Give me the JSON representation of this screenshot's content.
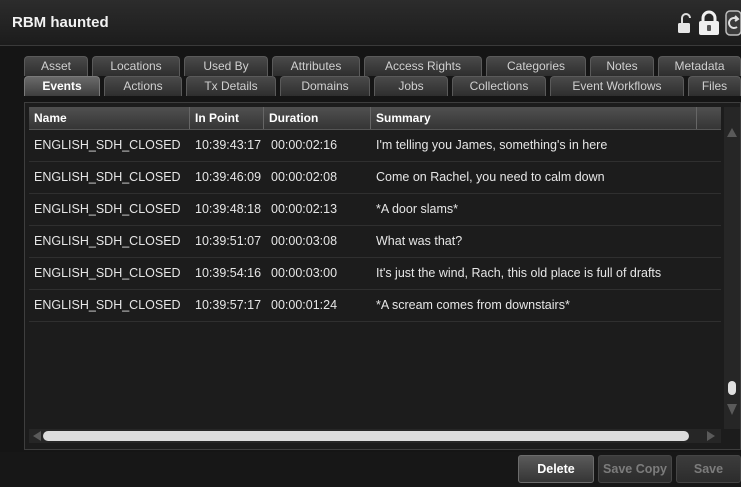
{
  "window": {
    "title": "RBM haunted"
  },
  "toolbar_icons": [
    "unlock-icon",
    "lock-icon",
    "refresh-icon"
  ],
  "tabs": {
    "back_row": [
      "Asset",
      "Locations",
      "Used By",
      "Attributes",
      "Access Rights",
      "Categories",
      "Notes",
      "Metadata"
    ],
    "front_row": [
      "Events",
      "Actions",
      "Tx Details",
      "Domains",
      "Jobs",
      "Collections",
      "Event Workflows",
      "Files"
    ],
    "active": "Events"
  },
  "grid": {
    "columns": [
      "Name",
      "In Point",
      "Duration",
      "Summary"
    ],
    "rows": [
      {
        "name": "ENGLISH_SDH_CLOSED",
        "in_point": "10:39:43:17",
        "duration": "00:00:02:16",
        "summary": "I'm telling you James, something's in here"
      },
      {
        "name": "ENGLISH_SDH_CLOSED",
        "in_point": "10:39:46:09",
        "duration": "00:00:02:08",
        "summary": "Come on Rachel, you need to calm down"
      },
      {
        "name": "ENGLISH_SDH_CLOSED",
        "in_point": "10:39:48:18",
        "duration": "00:00:02:13",
        "summary": "*A door slams*"
      },
      {
        "name": "ENGLISH_SDH_CLOSED",
        "in_point": "10:39:51:07",
        "duration": "00:00:03:08",
        "summary": "What was that?"
      },
      {
        "name": "ENGLISH_SDH_CLOSED",
        "in_point": "10:39:54:16",
        "duration": "00:00:03:00",
        "summary": "It's just the wind, Rach, this old place is full of drafts"
      },
      {
        "name": "ENGLISH_SDH_CLOSED",
        "in_point": "10:39:57:17",
        "duration": "00:00:01:24",
        "summary": "*A scream comes from downstairs*"
      }
    ]
  },
  "buttons": {
    "delete": "Delete",
    "save_copy": "Save Copy",
    "save": "Save"
  }
}
